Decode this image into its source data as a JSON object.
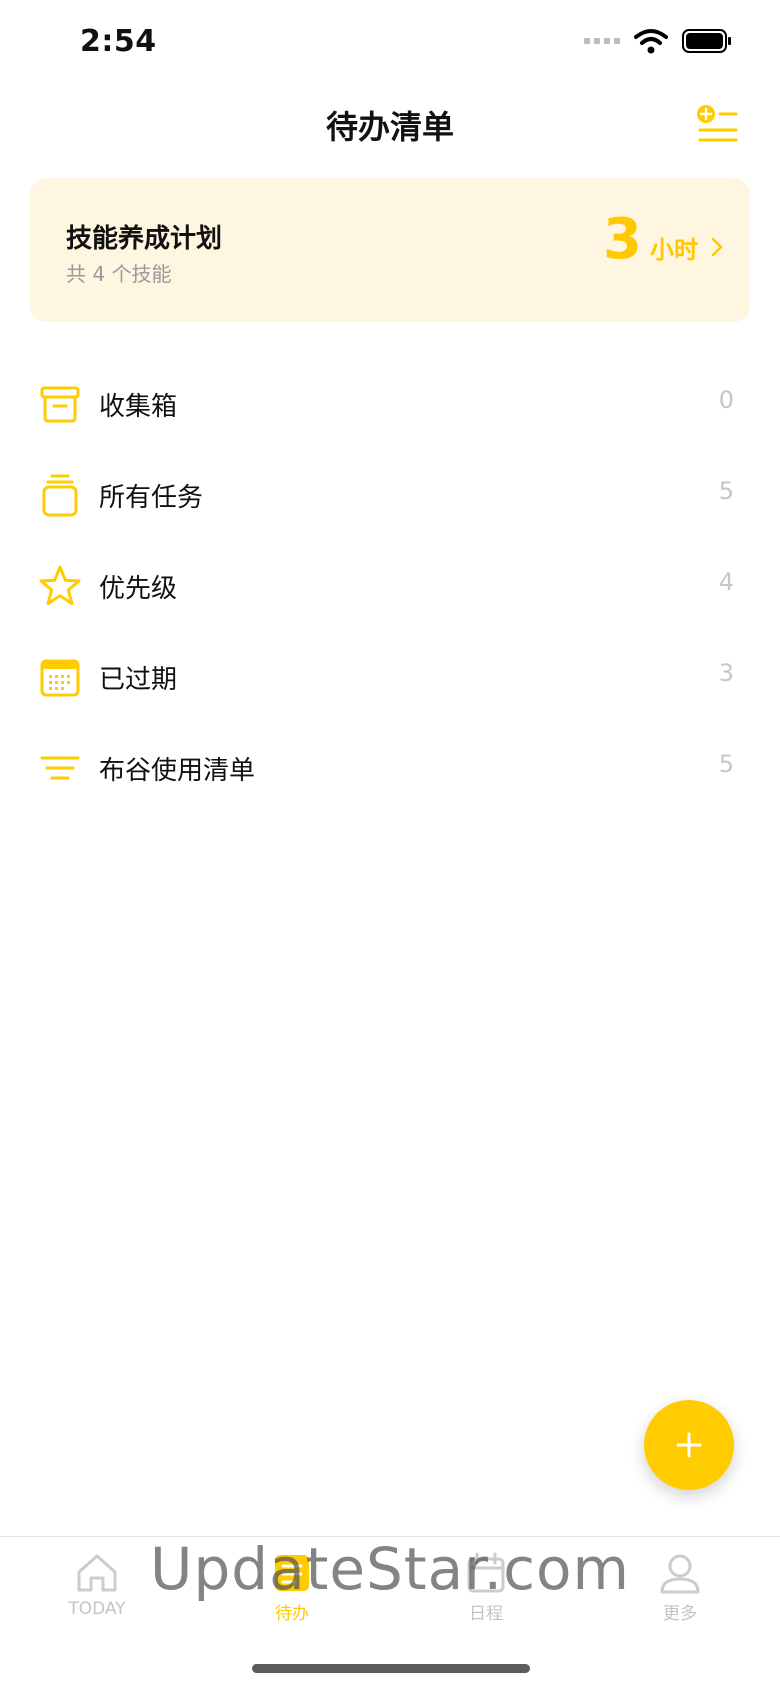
{
  "status_bar": {
    "time": "2:54"
  },
  "header": {
    "title": "待办清单"
  },
  "skill_card": {
    "title": "技能养成计划",
    "subtitle": "共 4 个技能",
    "hours_value": "3",
    "hours_unit": "小时"
  },
  "list": [
    {
      "label": "收集箱",
      "count": "0",
      "icon": "inbox-icon"
    },
    {
      "label": "所有任务",
      "count": "5",
      "icon": "all-tasks-icon"
    },
    {
      "label": "优先级",
      "count": "4",
      "icon": "star-icon"
    },
    {
      "label": "已过期",
      "count": "3",
      "icon": "calendar-icon"
    },
    {
      "label": "布谷使用清单",
      "count": "5",
      "icon": "list-icon"
    }
  ],
  "tabs": [
    {
      "label": "TODAY",
      "icon": "home-icon",
      "active": false
    },
    {
      "label": "待办",
      "icon": "todo-icon",
      "active": true
    },
    {
      "label": "日程",
      "icon": "calendar-icon",
      "active": false
    },
    {
      "label": "更多",
      "icon": "profile-icon",
      "active": false
    }
  ],
  "watermark": "UpdateStar.com",
  "colors": {
    "accent": "#ffcc00",
    "card_bg": "#fff6e1",
    "muted": "#c4c4c4"
  }
}
